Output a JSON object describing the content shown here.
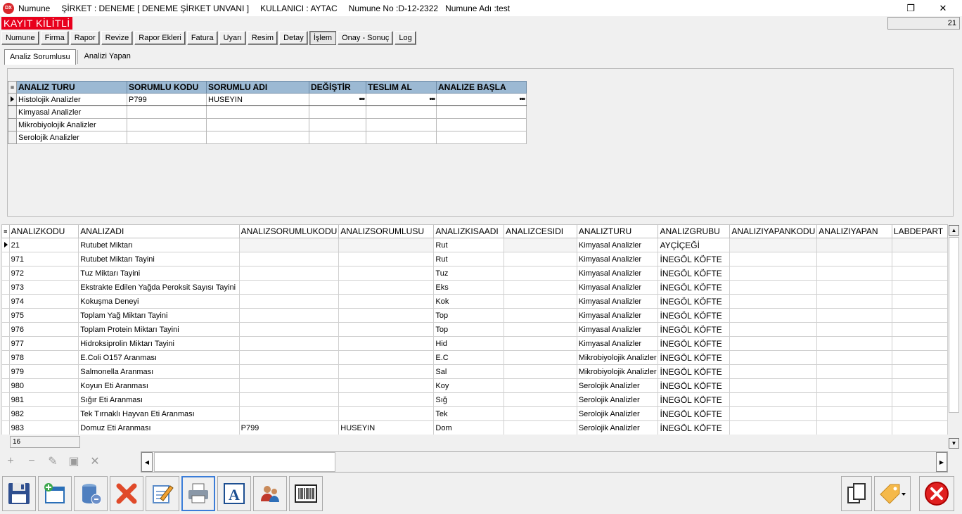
{
  "titlebar": {
    "app_icon": "DX",
    "app": "Numune",
    "company": "ŞİRKET : DENEME [ DENEME ŞİRKET UNVANI ]",
    "user": "KULLANICI : AYTAC",
    "sample_no": "Numune No :D-12-2322",
    "sample_name": "Numune Adı :test",
    "restore_icon": "❐",
    "close_icon": "✕"
  },
  "lock_label": "KAYIT KİLİTLİ",
  "record_counter": "21",
  "main_tabs": [
    "Numune",
    "Firma",
    "Rapor",
    "Revize",
    "Rapor Ekleri",
    "Fatura",
    "Uyarı",
    "Resim",
    "Detay",
    "İşlem",
    "Onay - Sonuç",
    "Log"
  ],
  "active_main_tab": "İşlem",
  "sub_tabs": [
    "Analiz Sorumlusu",
    "Analizi Yapan"
  ],
  "top_grid": {
    "columns": [
      "ANALIZ TURU",
      "SORUMLU KODU",
      "SORUMLU ADI",
      "DEĞİŞTİR",
      "TESLIM AL",
      "ANALIZE BAŞLA"
    ],
    "dots": "•••",
    "rows": [
      [
        "Histolojik Analizler",
        "P799",
        "HUSEYIN",
        "",
        "",
        ""
      ],
      [
        "Kimyasal Analizler",
        "",
        "",
        "",
        "",
        ""
      ],
      [
        "Mikrobiyolojik Analizler",
        "",
        "",
        "",
        "",
        ""
      ],
      [
        "Serolojik Analizler",
        "",
        "",
        "",
        "",
        ""
      ]
    ]
  },
  "bottom_grid": {
    "columns": [
      "ANALIZKODU",
      "ANALIZADI",
      "ANALIZSORUMLUKODU",
      "ANALIZSORUMLUSU",
      "ANALIZKISAADI",
      "ANALIZCESIDI",
      "ANALIZTURU",
      "ANALIZGRUBU",
      "ANALIZIYAPANKODU",
      "ANALIZIYAPAN",
      "LABDEPART"
    ],
    "rows": [
      [
        "21",
        "Rutubet Miktarı",
        "",
        "",
        "Rut",
        "",
        "Kimyasal Analizler",
        "AYÇİÇEĞİ",
        "",
        "",
        ""
      ],
      [
        "971",
        "Rutubet Miktarı Tayini",
        "",
        "",
        "Rut",
        "",
        "Kimyasal Analizler",
        "İNEGÖL KÖFTE",
        "",
        "",
        ""
      ],
      [
        "972",
        "Tuz Miktarı Tayini",
        "",
        "",
        "Tuz",
        "",
        "Kimyasal Analizler",
        "İNEGÖL KÖFTE",
        "",
        "",
        ""
      ],
      [
        "973",
        "Ekstrakte Edilen Yağda Peroksit Sayısı Tayini",
        "",
        "",
        "Eks",
        "",
        "Kimyasal Analizler",
        "İNEGÖL KÖFTE",
        "",
        "",
        ""
      ],
      [
        "974",
        "Kokuşma Deneyi",
        "",
        "",
        "Kok",
        "",
        "Kimyasal Analizler",
        "İNEGÖL KÖFTE",
        "",
        "",
        ""
      ],
      [
        "975",
        "Toplam Yağ Miktarı Tayini",
        "",
        "",
        "Top",
        "",
        "Kimyasal Analizler",
        "İNEGÖL KÖFTE",
        "",
        "",
        ""
      ],
      [
        "976",
        "Toplam Protein Miktarı Tayini",
        "",
        "",
        "Top",
        "",
        "Kimyasal Analizler",
        "İNEGÖL KÖFTE",
        "",
        "",
        ""
      ],
      [
        "977",
        "Hidroksiprolin Miktarı Tayini",
        "",
        "",
        "Hid",
        "",
        "Kimyasal Analizler",
        "İNEGÖL KÖFTE",
        "",
        "",
        ""
      ],
      [
        "978",
        "E.Coli O157 Aranması",
        "",
        "",
        "E.C",
        "",
        "Mikrobiyolojik Analizler",
        "İNEGÖL KÖFTE",
        "",
        "",
        ""
      ],
      [
        "979",
        "Salmonella Aranması",
        "",
        "",
        "Sal",
        "",
        "Mikrobiyolojik Analizler",
        "İNEGÖL KÖFTE",
        "",
        "",
        ""
      ],
      [
        "980",
        "Koyun Eti Aranması",
        "",
        "",
        "Koy",
        "",
        "Serolojik Analizler",
        "İNEGÖL KÖFTE",
        "",
        "",
        ""
      ],
      [
        "981",
        "Sığır Eti Aranması",
        "",
        "",
        "Sığ",
        "",
        "Serolojik Analizler",
        "İNEGÖL KÖFTE",
        "",
        "",
        ""
      ],
      [
        "982",
        "Tek Tırnaklı Hayvan Eti Aranması",
        "",
        "",
        "Tek",
        "",
        "Serolojik Analizler",
        "İNEGÖL KÖFTE",
        "",
        "",
        ""
      ],
      [
        "983",
        "Domuz Eti Aranması",
        "P799",
        "HUSEYIN",
        "Dom",
        "",
        "Serolojik Analizler",
        "İNEGÖL KÖFTE",
        "",
        "",
        ""
      ]
    ]
  },
  "footer_count": "16",
  "nav_buttons": [
    {
      "name": "add-record-button",
      "glyph": "+"
    },
    {
      "name": "delete-record-button",
      "glyph": "−"
    },
    {
      "name": "edit-record-button",
      "glyph": "✎"
    },
    {
      "name": "save-record-button",
      "glyph": "▣"
    },
    {
      "name": "cancel-record-button",
      "glyph": "✕"
    }
  ],
  "scroll_arrows": {
    "up": "▲",
    "down": "▼",
    "left": "◀",
    "right": "▶"
  },
  "toolbar_icons": [
    "save-icon",
    "new-window-icon",
    "database-delete-icon",
    "cancel-icon",
    "edit-notes-icon",
    "printer-icon",
    "text-A-icon",
    "users-icon",
    "barcode-icon"
  ],
  "toolbar_right_icons": [
    "copy-icon",
    "tag-icon",
    "close-circle-icon"
  ],
  "glyph_A": "A"
}
